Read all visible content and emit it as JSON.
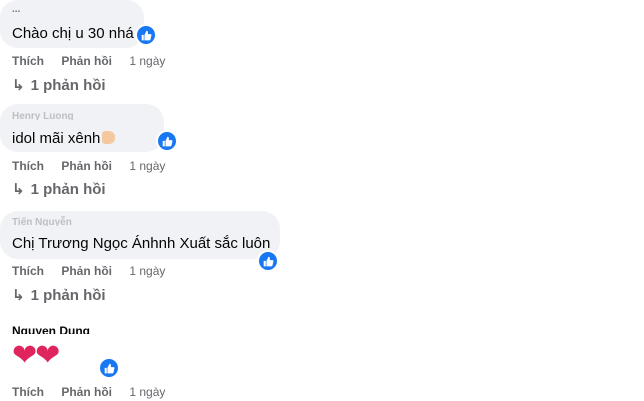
{
  "comments": [
    {
      "author": "...",
      "text_parts": [
        "Chào chị u 30 nhá"
      ],
      "actions": {
        "like": "Thích",
        "reply": "Phản hồi",
        "time": "1 ngày"
      },
      "replies": "1 phản hồi"
    },
    {
      "author": "Henry Luong",
      "text_parts": [
        "idol mãi xênh"
      ],
      "actions": {
        "like": "Thích",
        "reply": "Phản hồi",
        "time": "1 ngày"
      },
      "replies": "1 phản hồi"
    },
    {
      "author": "Tiến Nguyễn",
      "text_parts": [
        "Chị ",
        "Trương Ngọc Ánh",
        "nh Xuất sắc luôn"
      ],
      "actions": {
        "like": "Thích",
        "reply": "Phản hồi",
        "time": "1 ngày"
      },
      "replies": "1 phản hồi"
    },
    {
      "author": "Nguyen Dung",
      "text_parts": [
        "❤❤"
      ],
      "actions": {
        "like": "Thích",
        "reply": "Phản hồi",
        "time": "1 ngày"
      }
    }
  ],
  "icons": {
    "reaction": "like-thumb-icon",
    "reply_arrow": "reply-arrow-icon"
  },
  "colors": {
    "bubble": "#f0f2f5",
    "like_blue": "#1877f2",
    "muted": "#65676b"
  }
}
